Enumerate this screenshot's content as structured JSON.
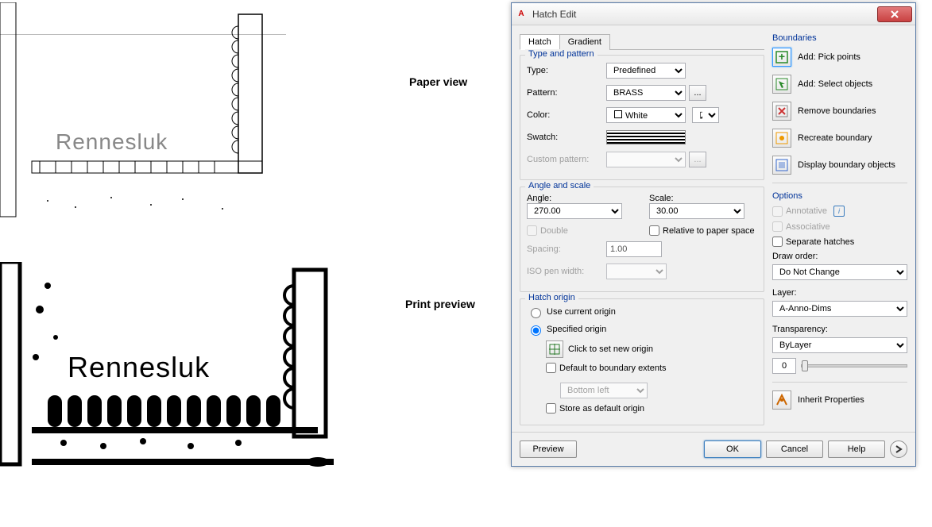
{
  "left": {
    "paper_view_label": "Paper view",
    "print_preview_label": "Print preview",
    "drawing_text": "Rennesluk"
  },
  "dialog": {
    "title": "Hatch Edit",
    "tabs": {
      "hatch": "Hatch",
      "gradient": "Gradient"
    },
    "type_pattern": {
      "legend": "Type and pattern",
      "type_label": "Type:",
      "type_value": "Predefined",
      "pattern_label": "Pattern:",
      "pattern_value": "BRASS",
      "color_label": "Color:",
      "color_value": "White",
      "swatch_label": "Swatch:",
      "custom_label": "Custom pattern:"
    },
    "angle_scale": {
      "legend": "Angle and scale",
      "angle_label": "Angle:",
      "angle_value": "270.00",
      "scale_label": "Scale:",
      "scale_value": "30.00",
      "double_label": "Double",
      "relative_label": "Relative to paper space",
      "spacing_label": "Spacing:",
      "spacing_value": "1.00",
      "iso_label": "ISO pen width:"
    },
    "origin": {
      "legend": "Hatch origin",
      "use_current": "Use current origin",
      "specified": "Specified origin",
      "click_new": "Click to set new origin",
      "default_extents": "Default to boundary extents",
      "extents_pos": "Bottom left",
      "store_default": "Store as default origin"
    },
    "boundaries": {
      "title": "Boundaries",
      "pick_points": "Add: Pick points",
      "select_objects": "Add: Select objects",
      "remove": "Remove boundaries",
      "recreate": "Recreate boundary",
      "display": "Display boundary objects"
    },
    "options": {
      "title": "Options",
      "annotative": "Annotative",
      "associative": "Associative",
      "separate": "Separate hatches",
      "draw_order_label": "Draw order:",
      "draw_order_value": "Do Not Change",
      "layer_label": "Layer:",
      "layer_value": "A-Anno-Dims",
      "transparency_label": "Transparency:",
      "transparency_value": "ByLayer",
      "transparency_num": "0"
    },
    "inherit": "Inherit Properties",
    "footer": {
      "preview": "Preview",
      "ok": "OK",
      "cancel": "Cancel",
      "help": "Help"
    }
  }
}
